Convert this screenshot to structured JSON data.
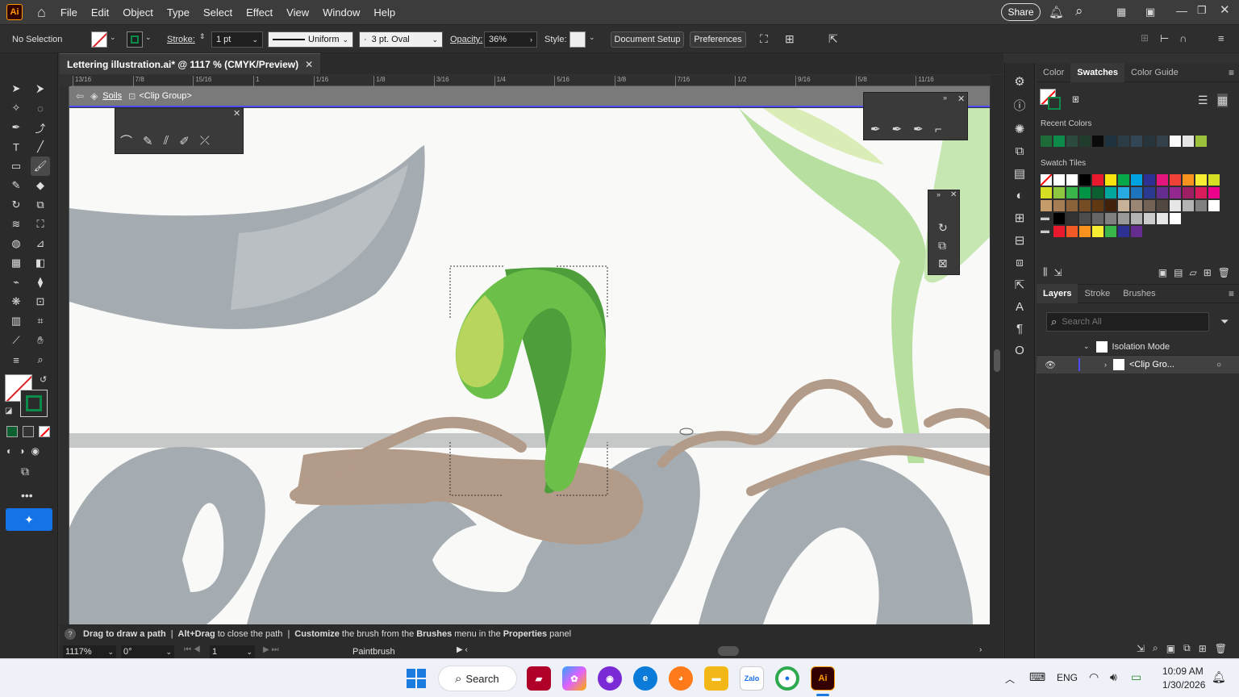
{
  "app": {
    "logo": "Ai",
    "menus": [
      "File",
      "Edit",
      "Object",
      "Type",
      "Select",
      "Effect",
      "View",
      "Window",
      "Help"
    ],
    "share_label": "Share"
  },
  "control_bar": {
    "selection": "No Selection",
    "stroke_label": "Stroke:",
    "stroke_value": "1 pt",
    "profile": "Uniform",
    "brush": "3 pt. Oval",
    "opacity_label": "Opacity:",
    "opacity_value": "36%",
    "style_label": "Style:",
    "document_setup": "Document Setup",
    "preferences": "Preferences"
  },
  "document": {
    "tab_title": "Lettering illustration.ai* @ 1117 % (CMYK/Preview)",
    "breadcrumb_layer": "Soils",
    "breadcrumb_group": "<Clip Group>",
    "ruler_labels": [
      "13/16",
      "7/8",
      "15/16",
      "1",
      "1/16",
      "1/8",
      "3/16",
      "1/4",
      "5/16",
      "3/8",
      "7/16",
      "1/2",
      "9/16",
      "5/8",
      "11/16"
    ]
  },
  "status": {
    "hint_parts": [
      "Drag to draw a path",
      "Alt+Drag",
      "to close the path",
      "Customize",
      "the brush from the",
      "Brushes",
      "menu in the",
      "Properties",
      "panel"
    ],
    "zoom": "1117%",
    "rotation": "0°",
    "artboard": "1",
    "tool": "Paintbrush"
  },
  "right_panel": {
    "tabs_top": [
      "Color",
      "Swatches",
      "Color Guide"
    ],
    "recent_colors_label": "Recent Colors",
    "swatch_tiles_label": "Swatch Tiles",
    "recent_colors": [
      "#1e6b3a",
      "#0b8a4a",
      "#2c4b3e",
      "#213c2d",
      "#0a0a0a",
      "#1f3240",
      "#2b3c46",
      "#334655",
      "#27343c",
      "#34404a",
      "#fafafa",
      "#e5e5e5",
      "#9bc23a"
    ],
    "tabs_bottom": [
      "Layers",
      "Stroke",
      "Brushes"
    ],
    "layers_search_placeholder": "Search All",
    "layers": [
      {
        "name": "Isolation Mode"
      },
      {
        "name": "<Clip Gro..."
      }
    ]
  },
  "taskbar": {
    "search_label": "Search",
    "language": "ENG",
    "time": "10:09 AM",
    "date": "1/30/2026"
  }
}
